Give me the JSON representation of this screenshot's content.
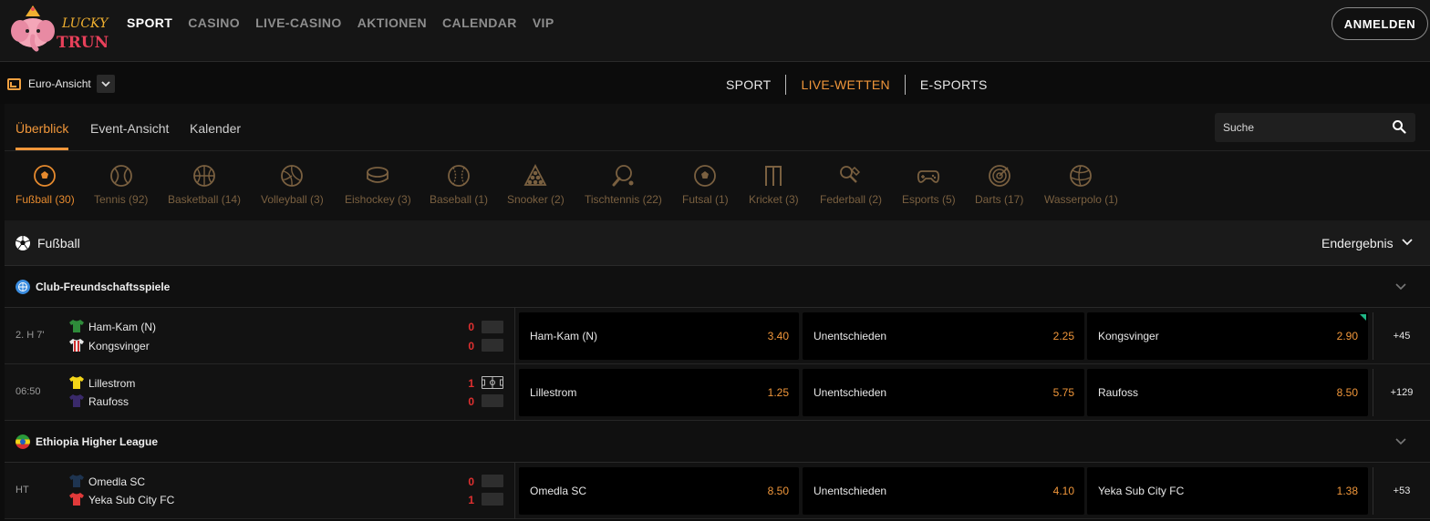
{
  "brand": {
    "logo_line1": "LUCKY",
    "logo_line2": "TRUNK"
  },
  "main_nav": [
    "SPORT",
    "CASINO",
    "LIVE-CASINO",
    "AKTIONEN",
    "CALENDAR",
    "VIP"
  ],
  "login_label": "ANMELDEN",
  "view_selector": {
    "label": "Euro-Ansicht"
  },
  "sub_nav": [
    "SPORT",
    "LIVE-WETTEN",
    "E-SPORTS"
  ],
  "tabs": [
    "Überblick",
    "Event-Ansicht",
    "Kalender"
  ],
  "search": {
    "placeholder": "Suche"
  },
  "sports": [
    {
      "label": "Fußball (30)",
      "icon": "soccer-ball-icon"
    },
    {
      "label": "Tennis (92)",
      "icon": "tennis-ball-icon"
    },
    {
      "label": "Basketball (14)",
      "icon": "basketball-icon"
    },
    {
      "label": "Volleyball (3)",
      "icon": "volleyball-icon"
    },
    {
      "label": "Eishockey (3)",
      "icon": "hockey-puck-icon"
    },
    {
      "label": "Baseball (1)",
      "icon": "baseball-icon"
    },
    {
      "label": "Snooker (2)",
      "icon": "snooker-rack-icon"
    },
    {
      "label": "Tischtennis (22)",
      "icon": "table-tennis-icon"
    },
    {
      "label": "Futsal (1)",
      "icon": "futsal-ball-icon"
    },
    {
      "label": "Kricket (3)",
      "icon": "cricket-wicket-icon"
    },
    {
      "label": "Federball (2)",
      "icon": "badminton-icon"
    },
    {
      "label": "Esports (5)",
      "icon": "gamepad-icon"
    },
    {
      "label": "Darts (17)",
      "icon": "dartboard-icon"
    },
    {
      "label": "Wasserpolo (1)",
      "icon": "waterpolo-ball-icon"
    }
  ],
  "section": {
    "title": "Fußball",
    "market": "Endergebnis"
  },
  "leagues": [
    {
      "name": "Club-Freundschaftsspiele",
      "matches": [
        {
          "time": "2. H 7'",
          "home": "Ham-Kam (N)",
          "away": "Kongsvinger",
          "home_score": "0",
          "away_score": "0",
          "odds": [
            {
              "label": "Ham-Kam (N)",
              "value": "3.40"
            },
            {
              "label": "Unentschieden",
              "value": "2.25"
            },
            {
              "label": "Kongsvinger",
              "value": "2.90"
            }
          ],
          "more": "+45"
        },
        {
          "time": "06:50",
          "home": "Lillestrom",
          "away": "Raufoss",
          "home_score": "1",
          "away_score": "0",
          "odds": [
            {
              "label": "Lillestrom",
              "value": "1.25"
            },
            {
              "label": "Unentschieden",
              "value": "5.75"
            },
            {
              "label": "Raufoss",
              "value": "8.50"
            }
          ],
          "more": "+129"
        }
      ]
    },
    {
      "name": "Ethiopia Higher League",
      "matches": [
        {
          "time": "HT",
          "home": "Omedla SC",
          "away": "Yeka Sub City FC",
          "home_score": "0",
          "away_score": "1",
          "odds": [
            {
              "label": "Omedla SC",
              "value": "8.50"
            },
            {
              "label": "Unentschieden",
              "value": "4.10"
            },
            {
              "label": "Yeka Sub City FC",
              "value": "1.38"
            }
          ],
          "more": "+53"
        }
      ]
    }
  ],
  "colors": {
    "accent": "#f0963a",
    "score_red": "#e03030",
    "odds_up": "#1fb886",
    "background": "#0d0d0d"
  }
}
